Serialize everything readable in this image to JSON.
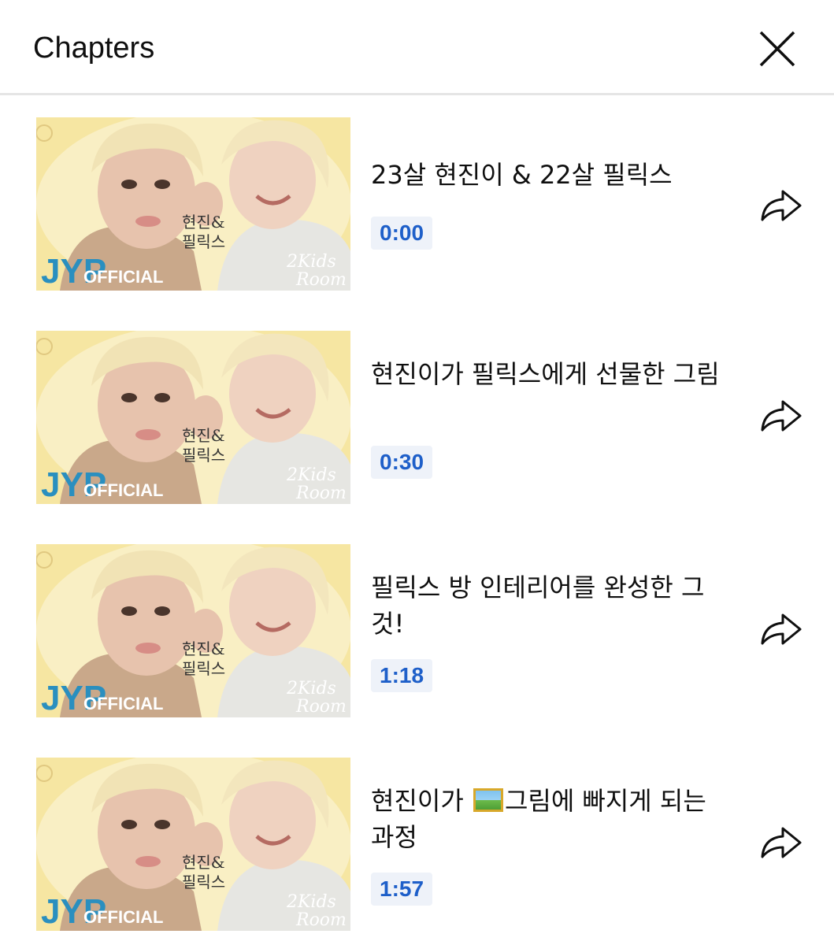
{
  "header": {
    "title": "Chapters",
    "close_icon": "close-icon"
  },
  "thumbnail": {
    "logo_main": "JYP",
    "logo_sub": "OFFICIAL",
    "caption_line1": "현진&",
    "caption_line2": "필릭스",
    "badge_line1": "2Kids",
    "badge_line2": "Room",
    "colors": {
      "background": "#f6e6a2",
      "logo": "#2a8fbf"
    }
  },
  "chapters": [
    {
      "title": "23살 현진이 & 22살 필릭스",
      "time": "0:00",
      "share_icon": "share-arrow-icon"
    },
    {
      "title": "현진이가 필릭스에게 선물한 그림",
      "time": "0:30",
      "share_icon": "share-arrow-icon"
    },
    {
      "title": "필릭스 방 인테리어를 완성한 그것!",
      "time": "1:18",
      "share_icon": "share-arrow-icon"
    },
    {
      "title_before": "현진이가 ",
      "title_emoji": "framed-picture-emoji",
      "title_after": "그림에 빠지게 되는 과정",
      "time": "1:57",
      "share_icon": "share-arrow-icon"
    }
  ]
}
